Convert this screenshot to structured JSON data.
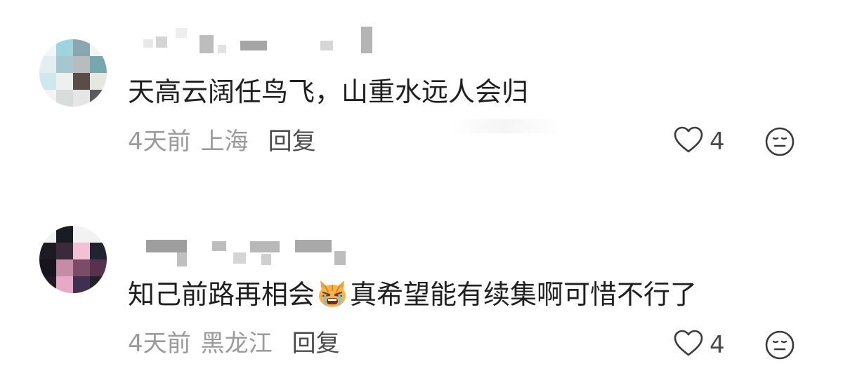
{
  "comments": [
    {
      "text": "天高云阔任鸟飞，山重水远人会归",
      "time": "4天前",
      "location": "上海",
      "reply_label": "回复",
      "likes": "4",
      "avatar_icon": "pixelated-avatar",
      "like_icon": "heart-outline-icon",
      "emote_icon": "neutral-face-icon"
    },
    {
      "text_before_emoji": "知己前路再相会",
      "emoji": "crying-cat-face-emoji",
      "text_after_emoji": "真希望能有续集啊可惜不行了",
      "time": "4天前",
      "location": "黑龙江",
      "reply_label": "回复",
      "likes": "4",
      "avatar_icon": "pixelated-avatar",
      "like_icon": "heart-outline-icon",
      "emote_icon": "neutral-face-icon"
    }
  ],
  "colors": {
    "text_primary": "#1f1f1f",
    "text_meta": "#9a9a9a",
    "text_reply": "#4a4a4a",
    "background": "#ffffff"
  }
}
